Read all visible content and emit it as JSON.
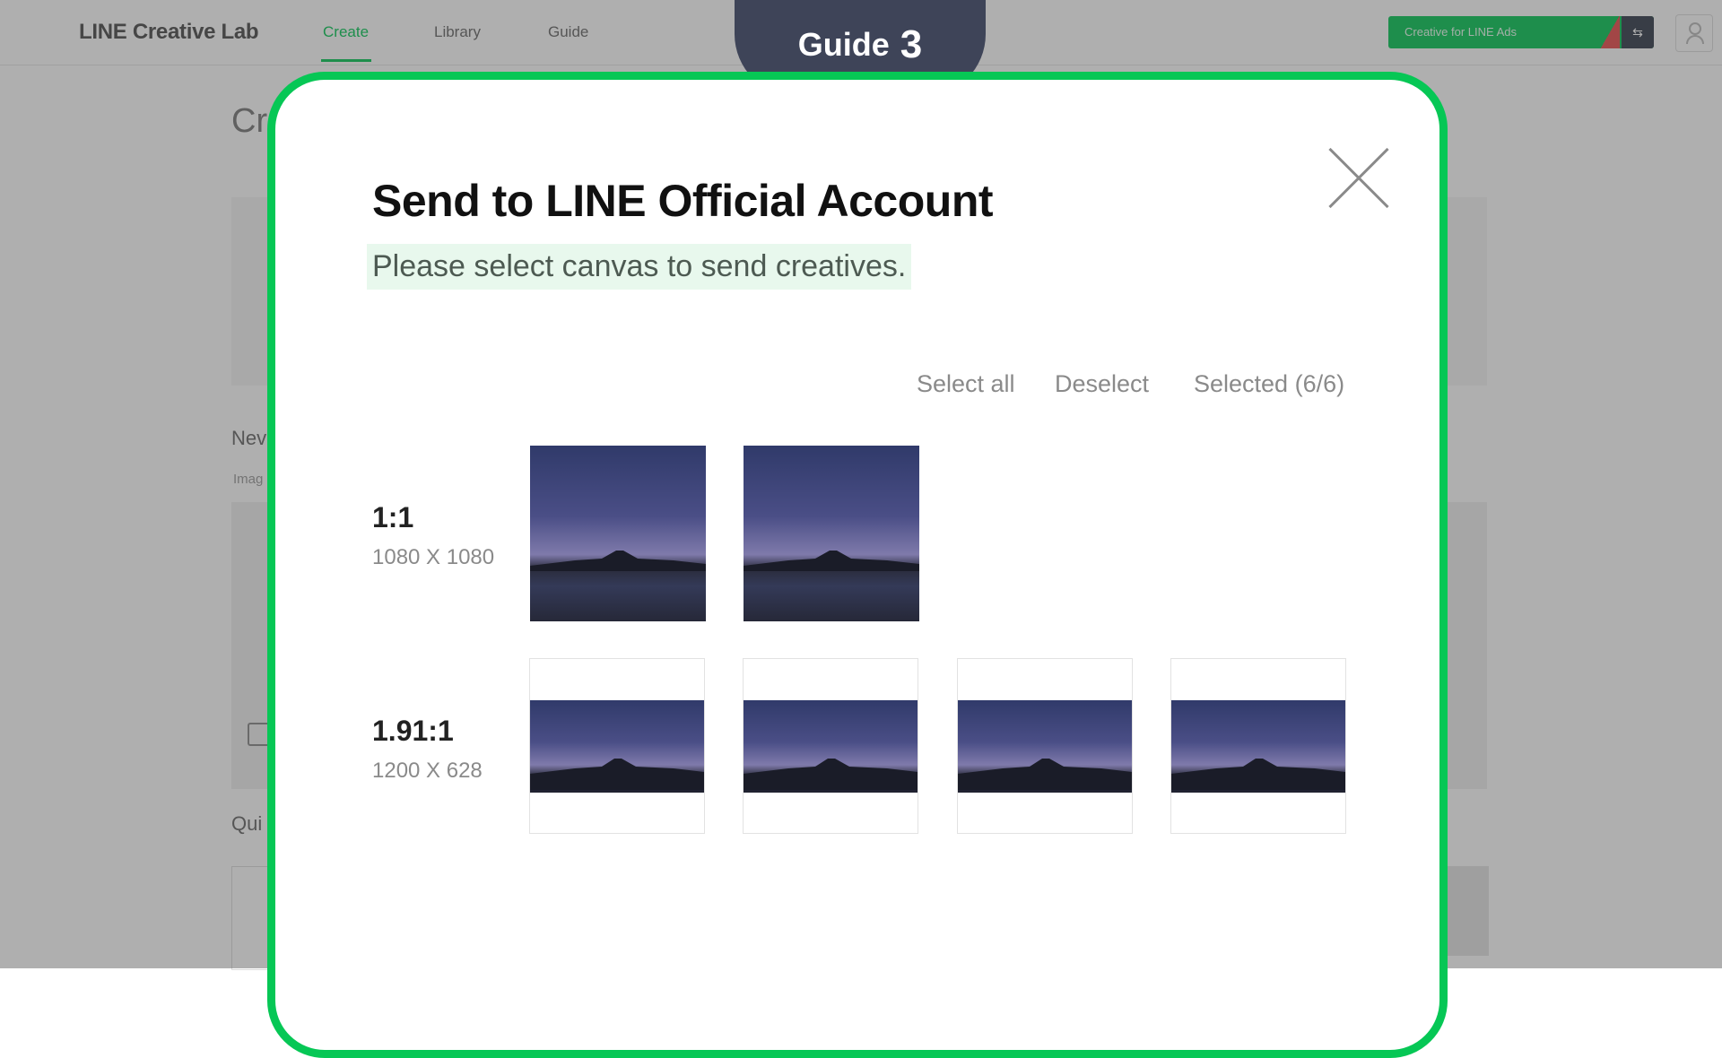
{
  "background_app": {
    "logo": "LINE Creative Lab",
    "nav": [
      "Create",
      "Library",
      "Guide"
    ],
    "ads_button_label": "Creative for LINE Ads",
    "page_title": "Cr",
    "section_new": "Nev",
    "section_image": "Imag",
    "section_quick": "Qui"
  },
  "guide": {
    "word": "Guide",
    "number": "3"
  },
  "modal": {
    "title": "Send to LINE Official Account",
    "subtitle": "Please select canvas to send creatives.",
    "actions": {
      "select_all": "Select all",
      "deselect": "Deselect",
      "selected": "Selected (6/6)"
    },
    "groups": [
      {
        "ratio": "1:1",
        "size": "1080 X 1080",
        "count": 2
      },
      {
        "ratio": "1.91:1",
        "size": "1200 X 628",
        "count": 4
      }
    ]
  },
  "colors": {
    "brand_green": "#06c755",
    "guide_tab": "#3e4458",
    "subtitle_highlight": "#e8f8ed"
  },
  "icons": [
    "close-icon",
    "user-icon",
    "external-link-icon"
  ]
}
